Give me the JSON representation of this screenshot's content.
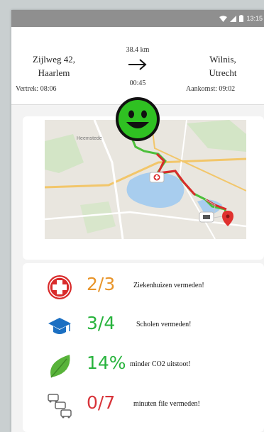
{
  "status_bar": {
    "time": "13:15"
  },
  "route": {
    "origin_line1": "Zijlweg 42,",
    "origin_line2": "Haarlem",
    "departure": "Vertrek: 08:06",
    "distance": "38.4 km",
    "duration": "00:45",
    "destination_line1": "Wilnis,",
    "destination_line2": "Utrecht",
    "arrival": "Aankomst: 09:02"
  },
  "rating": {
    "mood": "happy",
    "color": "#2fc122"
  },
  "map": {
    "label": "Heemstede"
  },
  "stats": [
    {
      "value": "2/3",
      "label": "Ziekenhuizen vermeden!",
      "icon": "hospital-cross-icon",
      "color": "#e8952b"
    },
    {
      "value": "3/4",
      "label": "Scholen vermeden!",
      "icon": "graduation-cap-icon",
      "color": "#27b33c"
    },
    {
      "value": "14%",
      "label": "minder CO2 uitstoot!",
      "icon": "leaf-icon",
      "color": "#27b33c"
    },
    {
      "value": "0/7",
      "label": "minuten file vermeden!",
      "icon": "traffic-jam-icon",
      "color": "#d8343a"
    }
  ]
}
